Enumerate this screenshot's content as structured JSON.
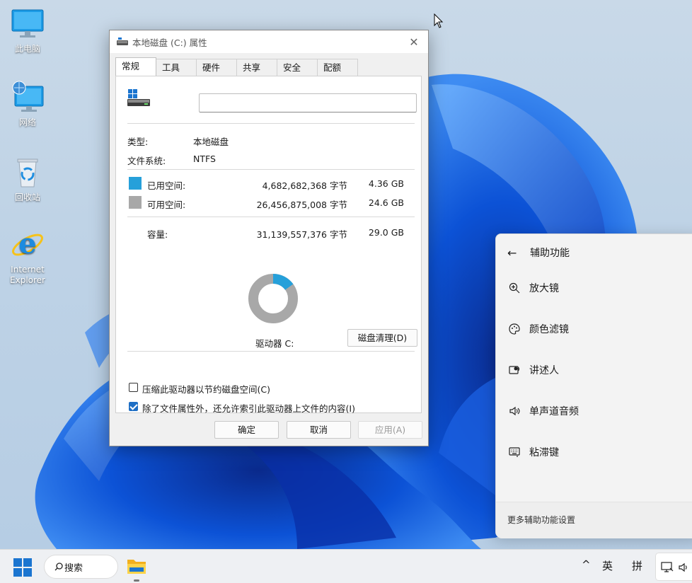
{
  "desktop": {
    "icons": [
      {
        "label": "此电脑"
      },
      {
        "label": "网络"
      },
      {
        "label": "回收站"
      },
      {
        "label": "Internet Explorer"
      }
    ]
  },
  "window": {
    "title": "本地磁盘 (C:) 属性",
    "close_glyph": "✕",
    "tabs": [
      "常规",
      "工具",
      "硬件",
      "共享",
      "安全",
      "配额"
    ],
    "active_tab": "常规",
    "name_value": "",
    "type_label": "类型:",
    "type_value": "本地磁盘",
    "fs_label": "文件系统:",
    "fs_value": "NTFS",
    "used_label": "已用空间:",
    "used_bytes": "4,682,682,368 字节",
    "used_gb": "4.36 GB",
    "free_label": "可用空间:",
    "free_bytes": "26,456,875,008 字节",
    "free_gb": "24.6 GB",
    "capacity_label": "容量:",
    "capacity_bytes": "31,139,557,376 字节",
    "capacity_gb": "29.0 GB",
    "used_fraction": 0.15,
    "drive_label": "驱动器 C:",
    "cleanup_button": "磁盘清理(D)",
    "compress_label": "压缩此驱动器以节约磁盘空间(C)",
    "compress_checked": false,
    "index_label": "除了文件属性外，还允许索引此驱动器上文件的内容(I)",
    "index_checked": true,
    "ok_button": "确定",
    "cancel_button": "取消",
    "apply_button": "应用(A)",
    "colors": {
      "used": "#26a0da",
      "free": "#a8a8a8"
    }
  },
  "flyout": {
    "title": "辅助功能",
    "items": [
      {
        "label": "放大镜",
        "icon": "zoom-in-icon"
      },
      {
        "label": "颜色滤镜",
        "icon": "palette-icon"
      },
      {
        "label": "讲述人",
        "icon": "narrator-icon"
      },
      {
        "label": "单声道音频",
        "icon": "speaker-icon"
      },
      {
        "label": "粘滞键",
        "icon": "keyboard-icon"
      }
    ],
    "footer": "更多辅助功能设置"
  },
  "taskbar": {
    "search_label": "搜索",
    "tray_chevron": "^",
    "ime_lang": "英",
    "ime_mode": "拼"
  }
}
